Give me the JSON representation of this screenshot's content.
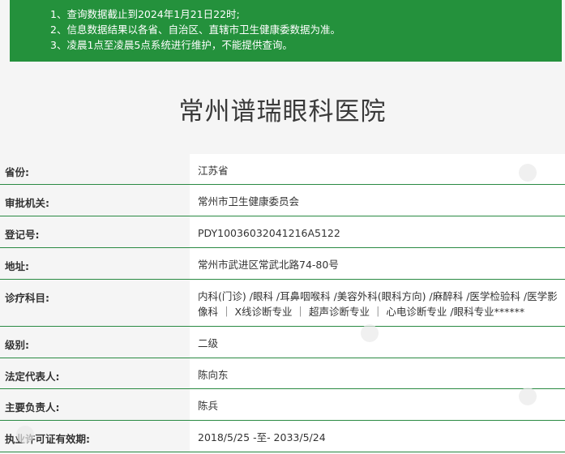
{
  "notice": {
    "lines": [
      "1、查询数据截止到2024年1月21日22时;",
      "2、信息数据结果以各省、自治区、直辖市卫生健康委数据为准。",
      "3、凌晨1点至凌晨5点系统进行维护，不能提供查询。"
    ]
  },
  "hospital": {
    "name": "常州谱瑞眼科医院"
  },
  "fields": [
    {
      "label": "省份:",
      "value": "江苏省"
    },
    {
      "label": "审批机关:",
      "value": "常州市卫生健康委员会"
    },
    {
      "label": "登记号:",
      "value": "PDY10036032041216A5122"
    },
    {
      "label": "地址:",
      "value": "常州市武进区常武北路74-80号"
    },
    {
      "label": "诊疗科目:",
      "value": "内科(门诊) /眼科 /耳鼻咽喉科 /美容外科(眼科方向) /麻醉科 /医学检验科 /医学影像科 ｜ X线诊断专业 ｜ 超声诊断专业 ｜ 心电诊断专业 /眼科专业******"
    },
    {
      "label": "级别:",
      "value": "二级"
    },
    {
      "label": "法定代表人:",
      "value": "陈向东"
    },
    {
      "label": "主要负责人:",
      "value": "陈兵"
    },
    {
      "label": "执业许可证有效期:",
      "value": "2018/5/25 -至- 2033/5/24"
    }
  ]
}
